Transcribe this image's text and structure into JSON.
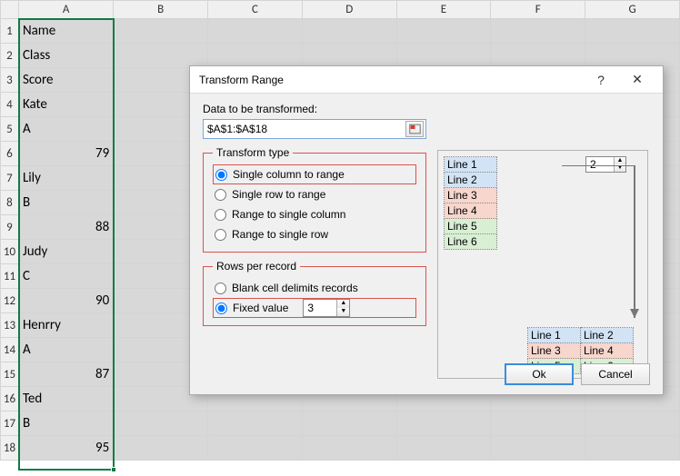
{
  "columns": [
    "A",
    "B",
    "C",
    "D",
    "E",
    "F",
    "G"
  ],
  "rows": [
    "Name",
    "Class",
    "Score",
    "Kate",
    "A",
    "79",
    "Lily",
    "B",
    "88",
    "Judy",
    "C",
    "90",
    "Henrry",
    "A",
    "87",
    "Ted",
    "B",
    "95"
  ],
  "numeric_rows": [
    6,
    9,
    12,
    15,
    18
  ],
  "dialog": {
    "title": "Transform Range",
    "help": "?",
    "close": "✕",
    "data_label": "Data to be transformed:",
    "range_value": "$A$1:$A$18",
    "transform_legend": "Transform type",
    "opts": {
      "col2range": "Single column to range",
      "row2range": "Single row to range",
      "range2col": "Range to single column",
      "range2row": "Range to single row"
    },
    "rows_legend": "Rows per record",
    "blank_label": "Blank cell delimits records",
    "fixed_label": "Fixed value",
    "fixed_value": "3",
    "preview": {
      "src": [
        "Line 1",
        "Line 2",
        "Line 3",
        "Line 4",
        "Line 5",
        "Line 6"
      ],
      "spin_value": "2"
    },
    "ok": "Ok",
    "cancel": "Cancel"
  }
}
